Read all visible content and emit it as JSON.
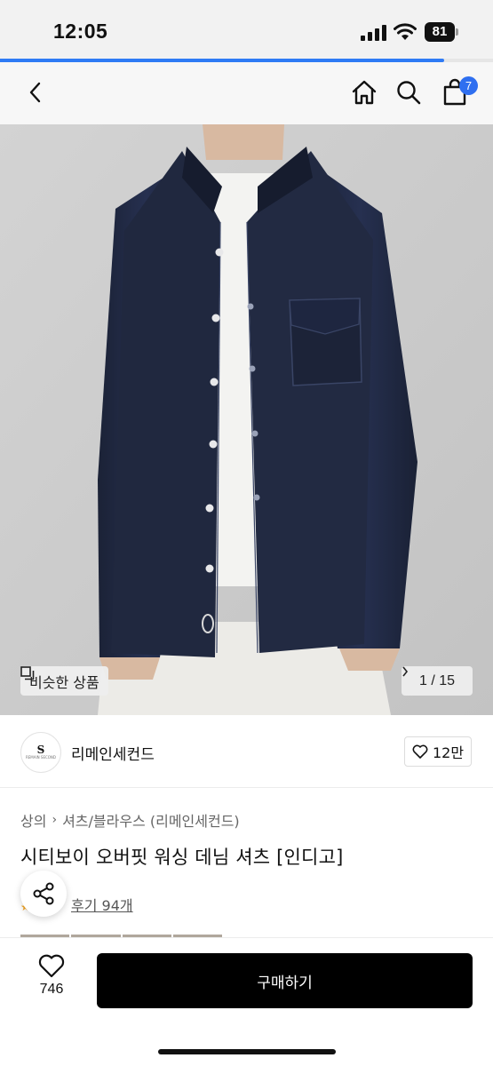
{
  "status_bar": {
    "time": "12:05",
    "battery": "81",
    "icons": [
      "signal-icon",
      "wifi-icon",
      "battery-icon"
    ]
  },
  "page_load_progress": 0.9,
  "nav": {
    "cart_badge": "7",
    "icons": [
      "back-icon",
      "home-icon",
      "search-icon",
      "cart-icon"
    ]
  },
  "hero": {
    "similar_label": "비슷한 상품",
    "counter": "1 / 15"
  },
  "brand": {
    "name": "리메인세컨드",
    "logo_letter": "S",
    "logo_text": "REMAIN SECOND",
    "likes": "12만"
  },
  "product": {
    "breadcrumb": [
      "상의",
      "셔츠/블라우스 (리메인세컨드)"
    ],
    "title": "시티보이 오버핏 워싱 데님 셔츠 [인디고]",
    "review_link": "후기 94개"
  },
  "bottom_bar": {
    "wish_count": "746",
    "buy_label": "구매하기"
  },
  "colors": {
    "accent": "#2f6ff0",
    "buy_button": "#000000",
    "denim": "#1f2740"
  }
}
